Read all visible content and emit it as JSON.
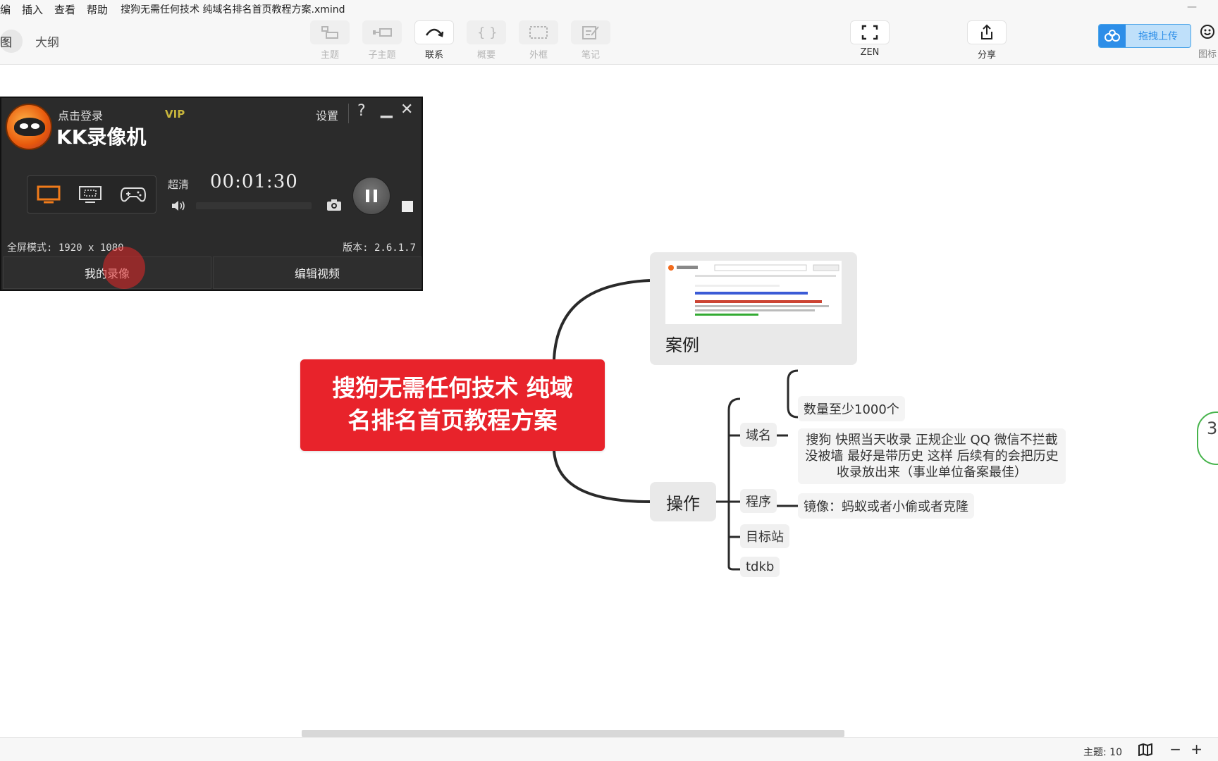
{
  "menubar": {
    "items": [
      "编",
      "插入",
      "查看",
      "帮助"
    ],
    "file_title": "搜狗无需任何技术 纯域名排名首页教程方案.xmind"
  },
  "toolbar": {
    "view_tabs": [
      "图",
      "大纲"
    ],
    "tools": [
      {
        "label": "主题",
        "icon": "topic-icon"
      },
      {
        "label": "子主题",
        "icon": "subtopic-icon"
      },
      {
        "label": "联系",
        "icon": "relationship-icon"
      },
      {
        "label": "概要",
        "icon": "summary-icon"
      },
      {
        "label": "外框",
        "icon": "boundary-icon"
      },
      {
        "label": "笔记",
        "icon": "note-icon"
      }
    ],
    "zen_label": "ZEN",
    "share_label": "分享",
    "upload_label": "拖拽上传",
    "emoji_label": "图标"
  },
  "mindmap": {
    "root": "搜狗无需任何技术 纯域名排名首页教程方案",
    "case_label": "案例",
    "operation_label": "操作",
    "sub_domain": "域名",
    "sub_program": "程序",
    "sub_target": "目标站",
    "sub_tdkb": "tdkb",
    "leaf_domain_count": "数量至少1000个",
    "leaf_domain_detail": "搜狗 快照当天收录 正规企业 QQ 微信不拦截 没被墙 最好是带历史 这样 后续有的会把历史收录放出来（事业单位备案最佳）",
    "leaf_program": "镜像：蚂蚁或者小偷或者克隆",
    "side_badge": "3"
  },
  "recorder": {
    "login_label": "点击登录",
    "vip_label": "VIP",
    "title": "KK录像机",
    "settings_label": "设置",
    "help_label": "?",
    "quality_label": "超清",
    "time": "00:01:30",
    "mode_text": "全屏模式: 1920 x 1080",
    "version_text": "版本: 2.6.1.7",
    "my_recordings_label": "我的录像",
    "edit_video_label": "编辑视频"
  },
  "status": {
    "topic_count": "主题: 10"
  },
  "colors": {
    "root_red": "#e8232b",
    "upload_blue": "#2d8ee8",
    "recorder_bg": "#2b2b2b",
    "vip_gold": "#c8b63c"
  }
}
